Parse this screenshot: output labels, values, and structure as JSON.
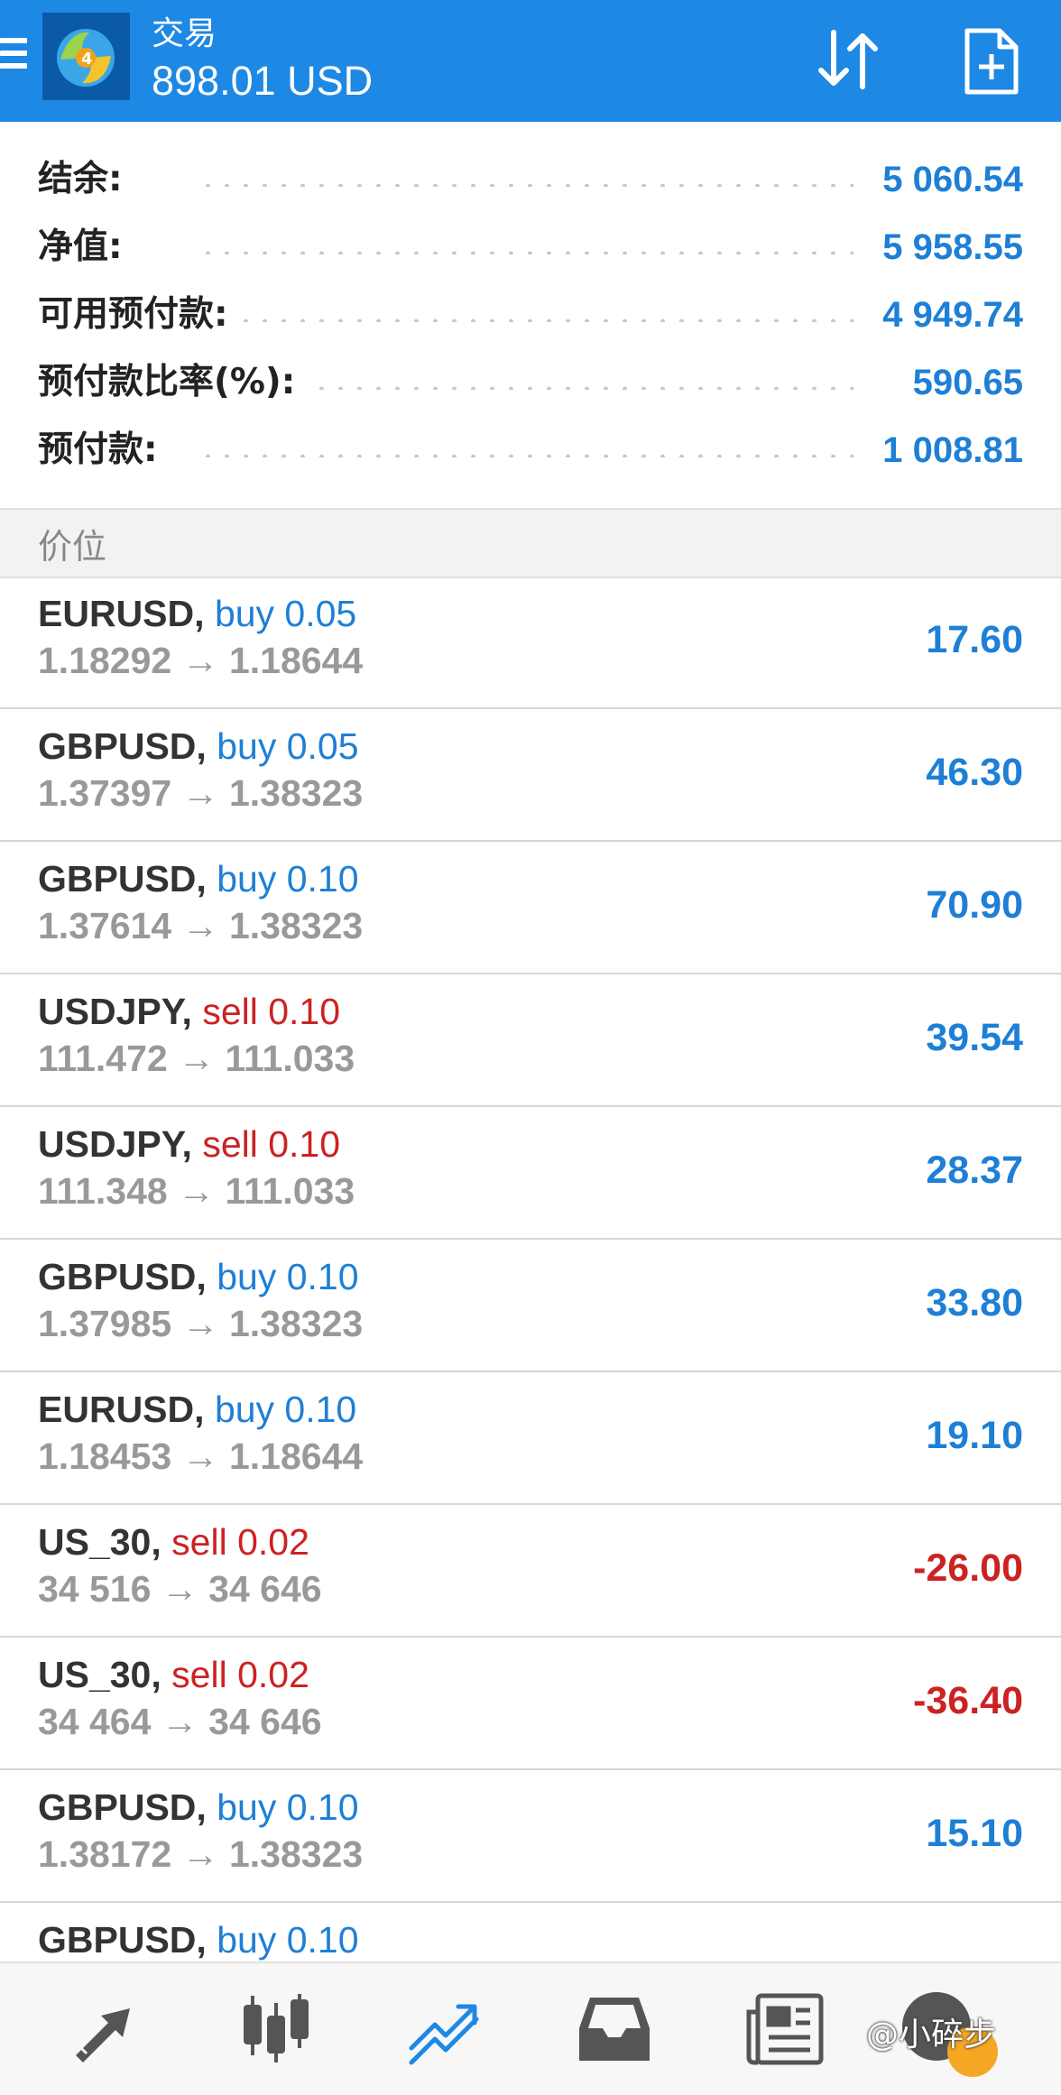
{
  "header": {
    "title": "交易",
    "balance": "898.01 USD"
  },
  "summary": [
    {
      "label": "结余:",
      "value": "5 060.54"
    },
    {
      "label": "净值:",
      "value": "5 958.55"
    },
    {
      "label": "可用预付款:",
      "value": "4 949.74"
    },
    {
      "label": "预付款比率(%):",
      "value": "590.65"
    },
    {
      "label": "预付款:",
      "value": "1 008.81"
    }
  ],
  "section": {
    "title": "价位"
  },
  "trades": [
    {
      "symbol": "EURUSD,",
      "direction": "buy 0.05",
      "prices": "1.18292 → 1.18644",
      "profit": "17.60"
    },
    {
      "symbol": "GBPUSD,",
      "direction": "buy 0.05",
      "prices": "1.37397 → 1.38323",
      "profit": "46.30"
    },
    {
      "symbol": "GBPUSD,",
      "direction": "buy 0.10",
      "prices": "1.37614 → 1.38323",
      "profit": "70.90"
    },
    {
      "symbol": "USDJPY,",
      "direction": "sell 0.10",
      "prices": "111.472 → 111.033",
      "profit": "39.54"
    },
    {
      "symbol": "USDJPY,",
      "direction": "sell 0.10",
      "prices": "111.348 → 111.033",
      "profit": "28.37"
    },
    {
      "symbol": "GBPUSD,",
      "direction": "buy 0.10",
      "prices": "1.37985 → 1.38323",
      "profit": "33.80"
    },
    {
      "symbol": "EURUSD,",
      "direction": "buy 0.10",
      "prices": "1.18453 → 1.18644",
      "profit": "19.10"
    },
    {
      "symbol": "US_30,",
      "direction": "sell 0.02",
      "prices": "34 516 → 34 646",
      "profit": "-26.00"
    },
    {
      "symbol": "US_30,",
      "direction": "sell 0.02",
      "prices": "34 464 → 34 646",
      "profit": "-36.40"
    },
    {
      "symbol": "GBPUSD,",
      "direction": "buy 0.10",
      "prices": "1.38172 → 1.38323",
      "profit": "15.10"
    },
    {
      "symbol": "GBPUSD,",
      "direction": "buy 0.10",
      "prices": "",
      "profit": ""
    }
  ],
  "nav": {
    "items": [
      "quotes-icon",
      "chart-icon",
      "trade-icon",
      "history-icon",
      "news-icon",
      "chat-icon"
    ],
    "active": "trade-icon"
  },
  "watermark": {
    "text": "@小碎步"
  },
  "colors": {
    "header_bg": "#1e88e5",
    "accent_blue": "#1e7fd6",
    "sell_red": "#cc2222",
    "muted_gray": "#999999"
  }
}
